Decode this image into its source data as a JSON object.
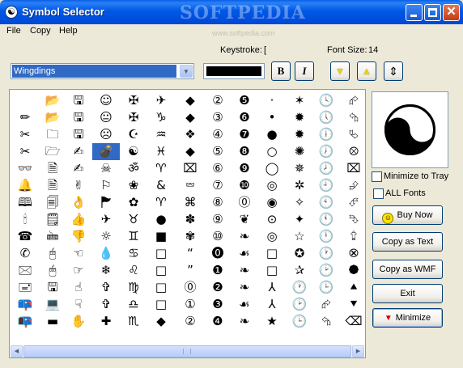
{
  "window": {
    "title": "Symbol Selector",
    "watermark": "SOFTPEDIA",
    "watermark_url": "www.softpedia.com",
    "controls": {
      "close": "✕"
    }
  },
  "menu": [
    "File",
    "Copy",
    "Help"
  ],
  "keystroke": {
    "label": "Keystroke:",
    "value": "["
  },
  "font_size": {
    "label": "Font Size:",
    "value": "14"
  },
  "font_select": {
    "value": "Wingdings"
  },
  "color": "#000000",
  "format": {
    "bold": "B",
    "italic": "I"
  },
  "size_buttons": {
    "decrease": "▼",
    "increase": "▲",
    "fit": "⇕"
  },
  "grid": {
    "selected": [
      3,
      3
    ],
    "rows": [
      [
        "",
        "📂",
        "🖫",
        "☺",
        "✠",
        "✈",
        "◆",
        "②",
        "❺",
        "·",
        "✶",
        "🕓",
        "⮳"
      ],
      [
        "✏",
        "📂",
        "🖫",
        "😐",
        "✠",
        "♑",
        "◆",
        "③",
        "❻",
        "•",
        "✹",
        "🕔",
        "⮲"
      ],
      [
        "✂",
        "🗀",
        "🖫",
        "☹",
        "☪",
        "♒",
        "❖",
        "④",
        "❼",
        "●",
        "✹",
        "🕕",
        "⮱"
      ],
      [
        "✂",
        "🗁",
        "✍",
        "💣",
        "☯",
        "♓",
        "◆",
        "⑤",
        "❽",
        "○",
        "✺",
        "🕖",
        "⮾"
      ],
      [
        "👓",
        "🗎",
        "✍",
        "☠",
        "ॐ",
        "♈",
        "⌧",
        "⑥",
        "❾",
        "◯",
        "✵",
        "🕗",
        "⌧"
      ],
      [
        "🔔",
        "🗎",
        "✌",
        "⚐",
        "❀",
        "&",
        "⮹",
        "⑦",
        "❿",
        "◎",
        "✲",
        "🕘",
        "⮵"
      ],
      [
        "🕮",
        "🗐",
        "👌",
        "🏲",
        "✿",
        "♈",
        "⌘",
        "⑧",
        "⓪",
        "◉",
        "✧",
        "🕙",
        "⮶"
      ],
      [
        "🕯",
        "🗒",
        "👍",
        "✈",
        "♉",
        "●",
        "✽",
        "⑨",
        "❦",
        "⊙",
        "✦",
        "🕚",
        "⮷"
      ],
      [
        "☎",
        "🖮",
        "👎",
        "☼",
        "♊",
        "■",
        "✾",
        "⑩",
        "❧",
        "◎",
        "☆",
        "🕛",
        "⮸"
      ],
      [
        "✆",
        "🖰",
        "☜",
        "💧",
        "♋",
        "□",
        "“",
        "⓿",
        "☙",
        "□",
        "✪",
        "🕐",
        "⮿"
      ],
      [
        "🖂",
        "🖱",
        "☞",
        "❄",
        "♌",
        "□",
        "”",
        "❶",
        "❧",
        "□",
        "✰",
        "🕑",
        "⯄"
      ],
      [
        "🖃",
        "🖫",
        "☝",
        "✞",
        "♍",
        "□",
        "⓪",
        "❷",
        "❧",
        "⅄",
        "🕐",
        "🕒",
        "⯅"
      ],
      [
        "📪",
        "💻",
        "☟",
        "✞",
        "♎",
        "□",
        "①",
        "❸",
        "☙",
        "⅄",
        "🕑",
        "⮳",
        "⯆"
      ],
      [
        "📭",
        "▬",
        "✋",
        "✚",
        "♏",
        "◆",
        "②",
        "❹",
        "❧",
        "★",
        "🕒",
        "⮲",
        "⌫"
      ]
    ]
  },
  "preview": {
    "symbol": "☯"
  },
  "options": {
    "minimize_to_tray": "Minimize to Tray",
    "all_fonts": "ALL Fonts"
  },
  "buttons": {
    "buy_now": "Buy Now",
    "copy_as_text": "Copy as Text",
    "copy_as_wmf": "Copy as WMF",
    "exit": "Exit",
    "minimize": "Minimize"
  },
  "icons": {
    "buy_now": "smiley-icon",
    "minimize": "red-down-triangle-icon"
  },
  "accent_colors": {
    "selection": "#316ac5",
    "titlebar": "#0058e6",
    "minimize_icon": "#d40000"
  }
}
